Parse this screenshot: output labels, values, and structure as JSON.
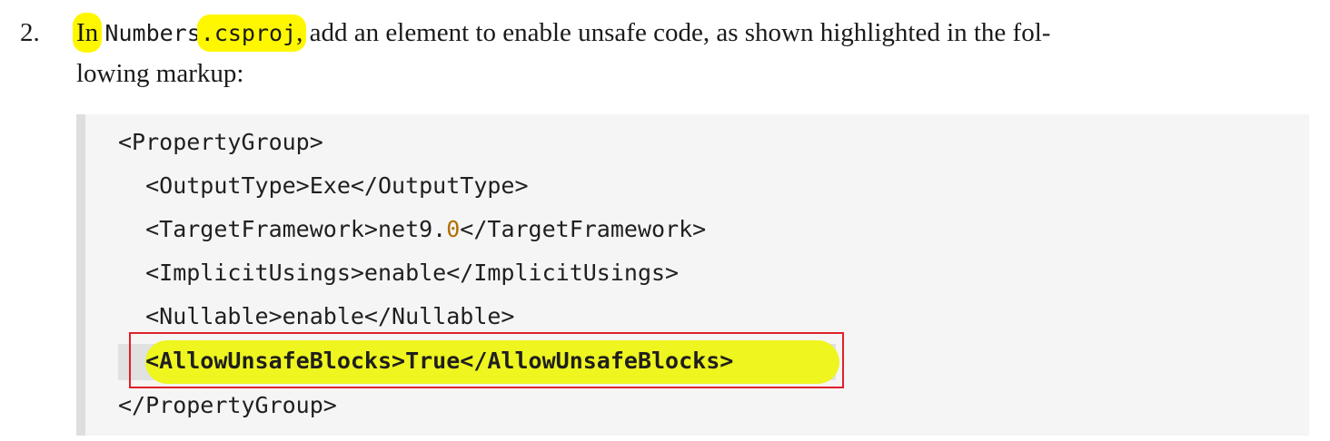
{
  "step": {
    "number": "2.",
    "line1": {
      "seg_in": "In",
      "seg_filename": "Numbers",
      "seg_ext": ".csproj",
      "seg_comma": ",",
      "seg_rest": " add an element to enable unsafe code, as shown highlighted in the fol-"
    },
    "line2": "lowing markup:"
  },
  "code": {
    "lines": [
      "<PropertyGroup>",
      "  <OutputType>Exe</OutputType>",
      "  <TargetFramework>net9.",
      "0",
      "</TargetFramework>",
      "  <ImplicitUsings>enable</ImplicitUsings>",
      "  <Nullable>enable</Nullable>",
      "  <AllowUnsafeBlocks>True</AllowUnsafeBlocks>",
      "</PropertyGroup>"
    ]
  },
  "colors": {
    "marker": "#fff700",
    "line_highlight": "#eef51f",
    "number_literal": "#b07100",
    "callout_border": "#e0202a"
  }
}
